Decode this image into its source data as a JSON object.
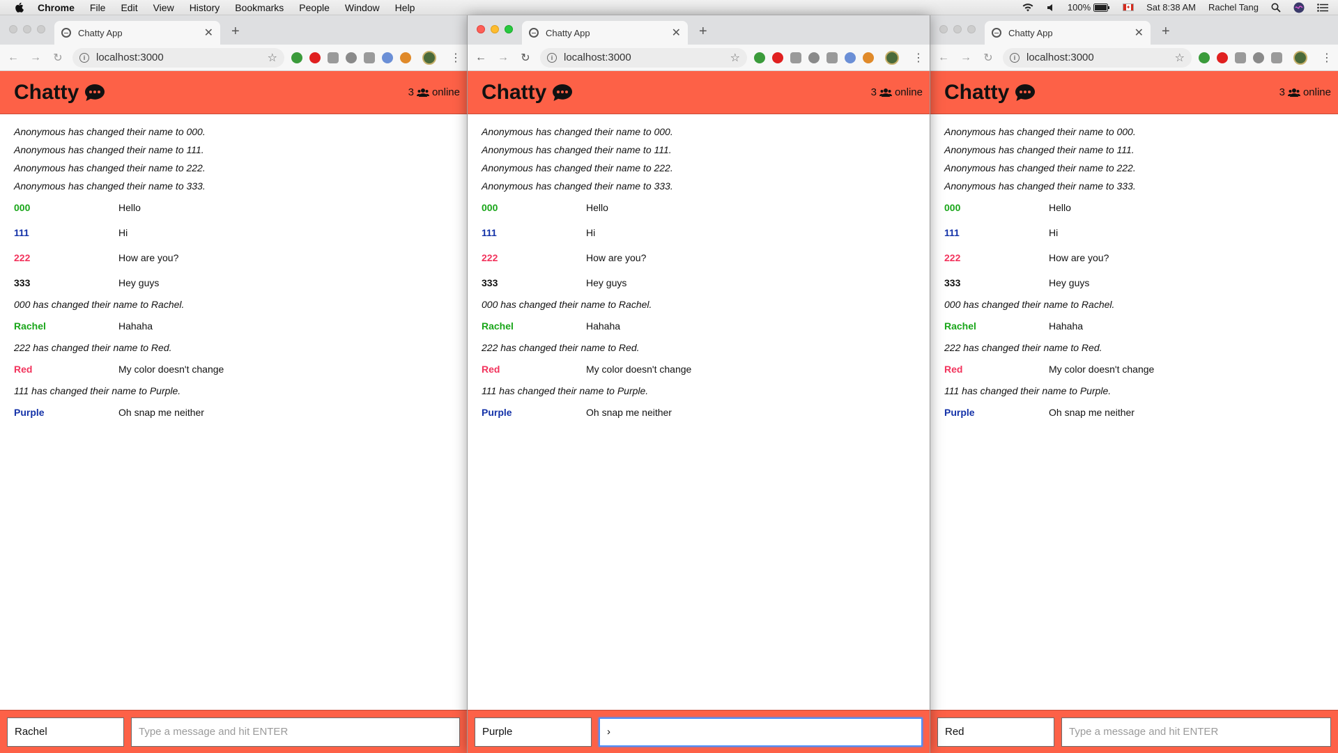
{
  "menubar": {
    "app_name": "Chrome",
    "items": [
      "File",
      "Edit",
      "View",
      "History",
      "Bookmarks",
      "People",
      "Window",
      "Help"
    ],
    "battery": "100%",
    "datetime": "Sat 8:38 AM",
    "user": "Rachel Tang"
  },
  "browser": {
    "tab_title": "Chatty App",
    "url": "localhost:3000"
  },
  "app": {
    "brand": "Chatty",
    "online_count": "3",
    "online_label": "online",
    "placeholder": "Type a message and hit ENTER",
    "colors": {
      "header": "#fd6147",
      "green": "#1aa61a",
      "blue": "#1432a8",
      "pink": "#f2335c",
      "black": "#111111"
    }
  },
  "messages": [
    {
      "type": "system",
      "text": "Anonymous has changed their name to 000."
    },
    {
      "type": "system",
      "text": "Anonymous has changed their name to 111."
    },
    {
      "type": "system",
      "text": "Anonymous has changed their name to 222."
    },
    {
      "type": "system",
      "text": "Anonymous has changed their name to 333."
    },
    {
      "type": "message",
      "user": "000",
      "content": "Hello",
      "color": "green"
    },
    {
      "type": "message",
      "user": "111",
      "content": "Hi",
      "color": "blue"
    },
    {
      "type": "message",
      "user": "222",
      "content": "How are you?",
      "color": "pink"
    },
    {
      "type": "message",
      "user": "333",
      "content": "Hey guys",
      "color": "black"
    },
    {
      "type": "system",
      "text": "000 has changed their name to Rachel."
    },
    {
      "type": "message",
      "user": "Rachel",
      "content": "Hahaha",
      "color": "green"
    },
    {
      "type": "system",
      "text": "222 has changed their name to Red."
    },
    {
      "type": "message",
      "user": "Red",
      "content": "My color doesn't change",
      "color": "pink"
    },
    {
      "type": "system",
      "text": "111 has changed their name to Purple."
    },
    {
      "type": "message",
      "user": "Purple",
      "content": "Oh snap me neither",
      "color": "blue"
    }
  ],
  "windows": [
    {
      "name_value": "Rachel",
      "message_value": ""
    },
    {
      "name_value": "Purple",
      "message_value": "›"
    },
    {
      "name_value": "Red",
      "message_value": ""
    }
  ]
}
